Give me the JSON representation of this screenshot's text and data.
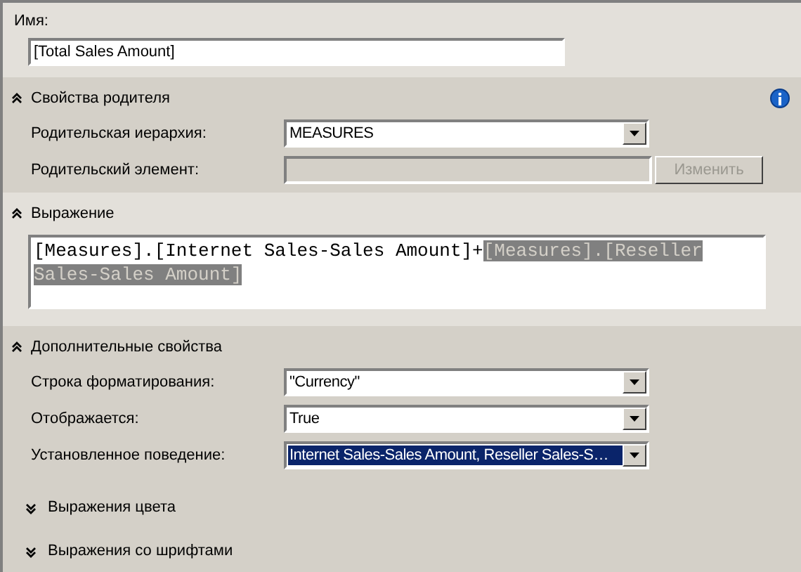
{
  "name_field": {
    "label": "Имя:",
    "value": "[Total Sales Amount]"
  },
  "sections": [
    {
      "kind": "parent",
      "title": "Свойства родителя",
      "expanded": true,
      "rows": [
        {
          "kind": "dropdown",
          "label": "Родительская иерархия:",
          "value": "MEASURES",
          "selected": false
        },
        {
          "kind": "picker",
          "label": "Родительский элемент:",
          "disabled": true,
          "button": {
            "label": "Изменить",
            "disabled": true
          }
        }
      ]
    },
    {
      "kind": "expression",
      "title": "Выражение",
      "expanded": true,
      "expression": [
        {
          "text": "[Measures].[Internet Sales-Sales Amount]+",
          "selected": false
        },
        {
          "text": "[Measures].[Reseller Sales-Sales Amount]",
          "selected": true
        }
      ]
    },
    {
      "kind": "properties",
      "title": "Дополнительные свойства",
      "expanded": true,
      "rows": [
        {
          "kind": "dropdown",
          "label": "Строка форматирования:",
          "value": "\"Currency\"",
          "selected": false
        },
        {
          "kind": "dropdown",
          "label": "Отображается:",
          "value": "True",
          "selected": false
        },
        {
          "kind": "dropdown",
          "label": "Установленное поведение:",
          "value": "Internet Sales-Sales Amount, Reseller Sales-S…",
          "selected": true
        }
      ],
      "subsections": [
        {
          "title": "Выражения цвета",
          "expanded": false
        },
        {
          "title": "Выражения со шрифтами",
          "expanded": false
        }
      ]
    }
  ]
}
